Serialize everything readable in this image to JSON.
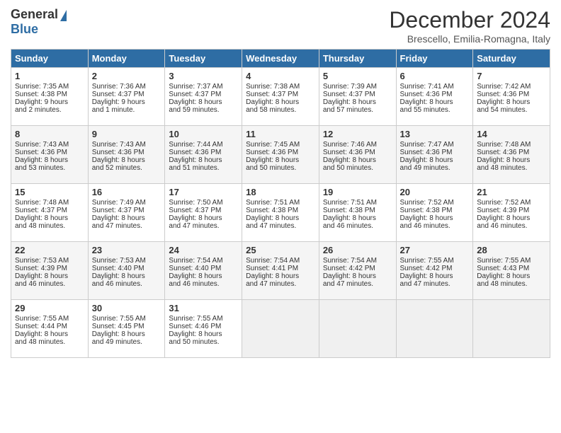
{
  "header": {
    "logo_general": "General",
    "logo_blue": "Blue",
    "month_title": "December 2024",
    "location": "Brescello, Emilia-Romagna, Italy"
  },
  "days_of_week": [
    "Sunday",
    "Monday",
    "Tuesday",
    "Wednesday",
    "Thursday",
    "Friday",
    "Saturday"
  ],
  "weeks": [
    [
      {
        "day": "1",
        "lines": [
          "Sunrise: 7:35 AM",
          "Sunset: 4:38 PM",
          "Daylight: 9 hours",
          "and 2 minutes."
        ]
      },
      {
        "day": "2",
        "lines": [
          "Sunrise: 7:36 AM",
          "Sunset: 4:37 PM",
          "Daylight: 9 hours",
          "and 1 minute."
        ]
      },
      {
        "day": "3",
        "lines": [
          "Sunrise: 7:37 AM",
          "Sunset: 4:37 PM",
          "Daylight: 8 hours",
          "and 59 minutes."
        ]
      },
      {
        "day": "4",
        "lines": [
          "Sunrise: 7:38 AM",
          "Sunset: 4:37 PM",
          "Daylight: 8 hours",
          "and 58 minutes."
        ]
      },
      {
        "day": "5",
        "lines": [
          "Sunrise: 7:39 AM",
          "Sunset: 4:37 PM",
          "Daylight: 8 hours",
          "and 57 minutes."
        ]
      },
      {
        "day": "6",
        "lines": [
          "Sunrise: 7:41 AM",
          "Sunset: 4:36 PM",
          "Daylight: 8 hours",
          "and 55 minutes."
        ]
      },
      {
        "day": "7",
        "lines": [
          "Sunrise: 7:42 AM",
          "Sunset: 4:36 PM",
          "Daylight: 8 hours",
          "and 54 minutes."
        ]
      }
    ],
    [
      {
        "day": "8",
        "lines": [
          "Sunrise: 7:43 AM",
          "Sunset: 4:36 PM",
          "Daylight: 8 hours",
          "and 53 minutes."
        ]
      },
      {
        "day": "9",
        "lines": [
          "Sunrise: 7:43 AM",
          "Sunset: 4:36 PM",
          "Daylight: 8 hours",
          "and 52 minutes."
        ]
      },
      {
        "day": "10",
        "lines": [
          "Sunrise: 7:44 AM",
          "Sunset: 4:36 PM",
          "Daylight: 8 hours",
          "and 51 minutes."
        ]
      },
      {
        "day": "11",
        "lines": [
          "Sunrise: 7:45 AM",
          "Sunset: 4:36 PM",
          "Daylight: 8 hours",
          "and 50 minutes."
        ]
      },
      {
        "day": "12",
        "lines": [
          "Sunrise: 7:46 AM",
          "Sunset: 4:36 PM",
          "Daylight: 8 hours",
          "and 50 minutes."
        ]
      },
      {
        "day": "13",
        "lines": [
          "Sunrise: 7:47 AM",
          "Sunset: 4:36 PM",
          "Daylight: 8 hours",
          "and 49 minutes."
        ]
      },
      {
        "day": "14",
        "lines": [
          "Sunrise: 7:48 AM",
          "Sunset: 4:36 PM",
          "Daylight: 8 hours",
          "and 48 minutes."
        ]
      }
    ],
    [
      {
        "day": "15",
        "lines": [
          "Sunrise: 7:48 AM",
          "Sunset: 4:37 PM",
          "Daylight: 8 hours",
          "and 48 minutes."
        ]
      },
      {
        "day": "16",
        "lines": [
          "Sunrise: 7:49 AM",
          "Sunset: 4:37 PM",
          "Daylight: 8 hours",
          "and 47 minutes."
        ]
      },
      {
        "day": "17",
        "lines": [
          "Sunrise: 7:50 AM",
          "Sunset: 4:37 PM",
          "Daylight: 8 hours",
          "and 47 minutes."
        ]
      },
      {
        "day": "18",
        "lines": [
          "Sunrise: 7:51 AM",
          "Sunset: 4:38 PM",
          "Daylight: 8 hours",
          "and 47 minutes."
        ]
      },
      {
        "day": "19",
        "lines": [
          "Sunrise: 7:51 AM",
          "Sunset: 4:38 PM",
          "Daylight: 8 hours",
          "and 46 minutes."
        ]
      },
      {
        "day": "20",
        "lines": [
          "Sunrise: 7:52 AM",
          "Sunset: 4:38 PM",
          "Daylight: 8 hours",
          "and 46 minutes."
        ]
      },
      {
        "day": "21",
        "lines": [
          "Sunrise: 7:52 AM",
          "Sunset: 4:39 PM",
          "Daylight: 8 hours",
          "and 46 minutes."
        ]
      }
    ],
    [
      {
        "day": "22",
        "lines": [
          "Sunrise: 7:53 AM",
          "Sunset: 4:39 PM",
          "Daylight: 8 hours",
          "and 46 minutes."
        ]
      },
      {
        "day": "23",
        "lines": [
          "Sunrise: 7:53 AM",
          "Sunset: 4:40 PM",
          "Daylight: 8 hours",
          "and 46 minutes."
        ]
      },
      {
        "day": "24",
        "lines": [
          "Sunrise: 7:54 AM",
          "Sunset: 4:40 PM",
          "Daylight: 8 hours",
          "and 46 minutes."
        ]
      },
      {
        "day": "25",
        "lines": [
          "Sunrise: 7:54 AM",
          "Sunset: 4:41 PM",
          "Daylight: 8 hours",
          "and 47 minutes."
        ]
      },
      {
        "day": "26",
        "lines": [
          "Sunrise: 7:54 AM",
          "Sunset: 4:42 PM",
          "Daylight: 8 hours",
          "and 47 minutes."
        ]
      },
      {
        "day": "27",
        "lines": [
          "Sunrise: 7:55 AM",
          "Sunset: 4:42 PM",
          "Daylight: 8 hours",
          "and 47 minutes."
        ]
      },
      {
        "day": "28",
        "lines": [
          "Sunrise: 7:55 AM",
          "Sunset: 4:43 PM",
          "Daylight: 8 hours",
          "and 48 minutes."
        ]
      }
    ],
    [
      {
        "day": "29",
        "lines": [
          "Sunrise: 7:55 AM",
          "Sunset: 4:44 PM",
          "Daylight: 8 hours",
          "and 48 minutes."
        ]
      },
      {
        "day": "30",
        "lines": [
          "Sunrise: 7:55 AM",
          "Sunset: 4:45 PM",
          "Daylight: 8 hours",
          "and 49 minutes."
        ]
      },
      {
        "day": "31",
        "lines": [
          "Sunrise: 7:55 AM",
          "Sunset: 4:46 PM",
          "Daylight: 8 hours",
          "and 50 minutes."
        ]
      },
      {
        "day": "",
        "lines": []
      },
      {
        "day": "",
        "lines": []
      },
      {
        "day": "",
        "lines": []
      },
      {
        "day": "",
        "lines": []
      }
    ]
  ]
}
